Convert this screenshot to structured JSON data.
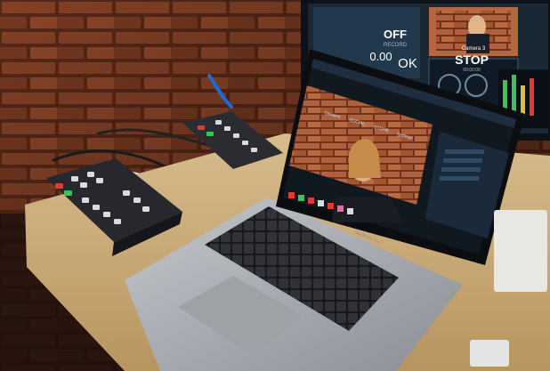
{
  "monitor": {
    "off_label": "OFF",
    "off_sublabel": "RECORD",
    "time_value": "0.00",
    "ok_label": "OK",
    "stop_label": "STOP",
    "stop_sublabel": "00:00:00",
    "camera_label": "Camera 3"
  },
  "laptop": {
    "brand_text": "MacBook Pro",
    "app_tabs": [
      "Streams",
      "SOCIAL",
      "STORE",
      "Settings"
    ]
  },
  "colors": {
    "brick": "#7a3a22",
    "brick_dark": "#4a2418",
    "desk": "#c9a978",
    "laptop_body": "#a9acb1",
    "keyboard": "#1d1e22",
    "screen_bg": "#101820",
    "accent_red": "#e13a2e",
    "accent_green": "#39c45a"
  }
}
